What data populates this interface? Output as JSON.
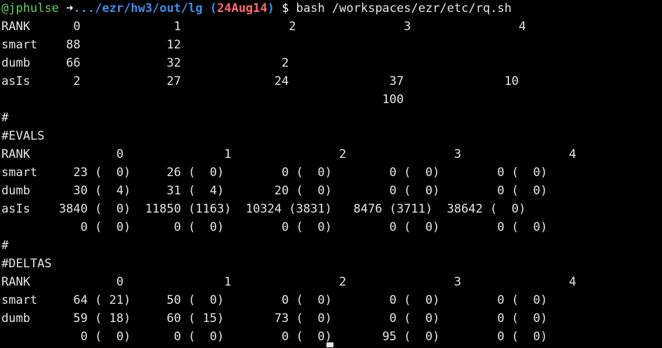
{
  "prompt": {
    "user": "@jphulse",
    "arrow": "➜",
    "path": ".../ezr/hw3/out/lg",
    "paren_open": " (",
    "branch": "24Aug14",
    "paren_close": ")",
    "symbol": " $ ",
    "command": "bash /workspaces/ezr/etc/rq.sh"
  },
  "output": {
    "section1": {
      "header": "RANK      0             1               2               3               4",
      "rows": [
        "smart    88            12",
        "dumb     66            32              2",
        "asIs      2            27             24              37              10",
        "                                                     100"
      ]
    },
    "sep1": "#",
    "evals": {
      "title": "#EVALS",
      "header": "RANK            0              1               2               3               4",
      "rows": [
        "smart     23 (  0)     26 (  0)        0 (  0)        0 (  0)        0 (  0)",
        "dumb      30 (  4)     31 (  4)       20 (  0)        0 (  0)        0 (  0)",
        "asIs    3840 (  0)  11850 (1163)  10324 (3831)   8476 (3711)  38642 (  0)",
        "           0 (  0)      0 (  0)        0 (  0)        0 (  0)        0 (  0)"
      ]
    },
    "sep2": "#",
    "deltas": {
      "title": "#DELTAS",
      "header": "RANK            0              1               2               3               4",
      "rows": [
        "smart     64 ( 21)     50 (  0)        0 (  0)        0 (  0)        0 (  0)",
        "dumb      59 ( 18)     60 ( 15)       73 (  0)        0 (  0)        0 (  0)",
        "           0 (  0)      0 (  0)        0 (  0)       95 (  0)        0 (  0)"
      ]
    }
  },
  "colors": {
    "background": "#000000",
    "text": "#e6e6e6",
    "user": "#5fd75f",
    "path": "#3b8eea",
    "branch": "#ff6b6b"
  }
}
